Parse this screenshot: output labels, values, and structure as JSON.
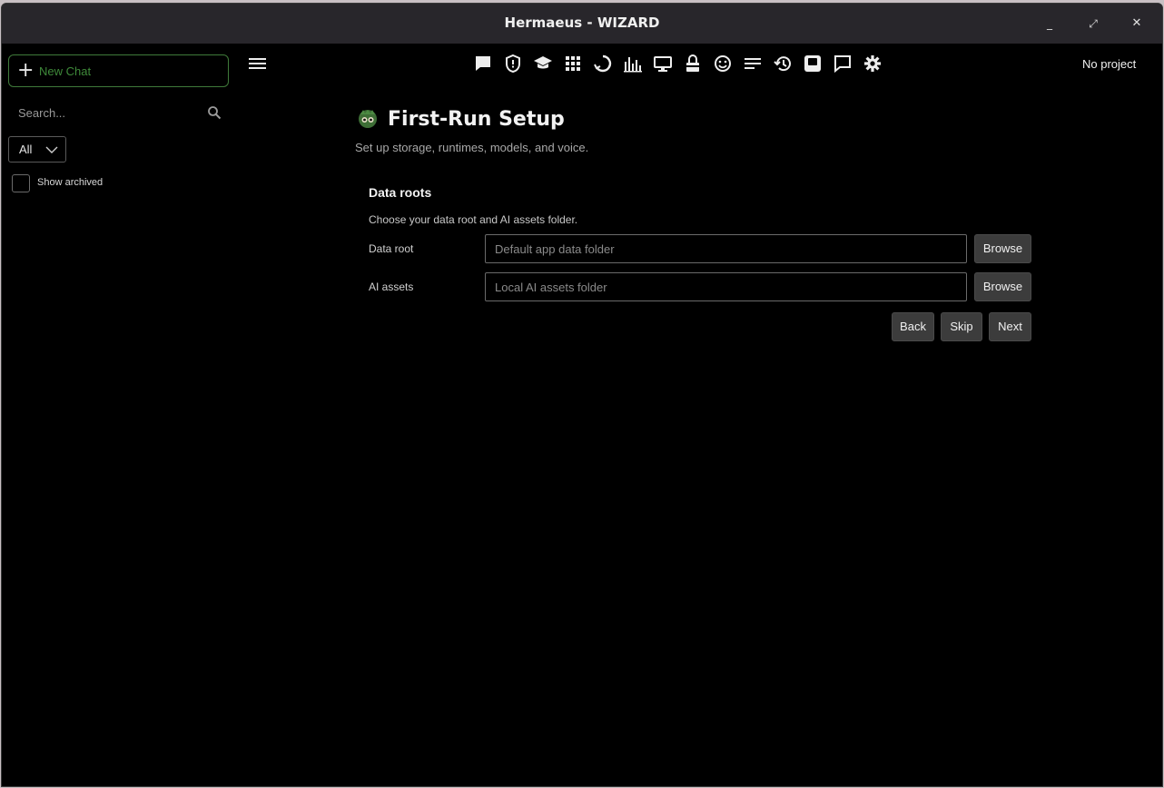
{
  "window": {
    "title": "Hermaeus - WIZARD",
    "minimize_glyph": "_",
    "maximize_glyph": "⤢",
    "close_glyph": "✕"
  },
  "sidebar": {
    "new_chat_label": "New Chat",
    "search_placeholder": "Search...",
    "filter_value": "All",
    "show_archived_label": "Show archived",
    "show_archived_checked": false
  },
  "toolbar": {
    "icons": [
      "chat-icon",
      "shield-icon",
      "graduation-cap-icon",
      "apps-grid-icon",
      "refresh-circle-icon",
      "bar-chart-icon",
      "monitor-icon",
      "lock-icon",
      "smiley-icon",
      "text-lines-icon",
      "history-icon",
      "active-panel-icon",
      "comment-icon",
      "gear-icon"
    ],
    "project_label": "No project"
  },
  "wizard": {
    "title": "First-Run Setup",
    "subtitle": "Set up storage, runtimes, models, and voice.",
    "section_title": "Data roots",
    "section_description": "Choose your data root and AI assets folder.",
    "fields": [
      {
        "label": "Data root",
        "placeholder": "Default app data folder",
        "value": "",
        "browse_label": "Browse"
      },
      {
        "label": "AI assets",
        "placeholder": "Local AI assets folder",
        "value": "",
        "browse_label": "Browse"
      }
    ],
    "buttons": {
      "back": "Back",
      "skip": "Skip",
      "next": "Next"
    }
  },
  "colors": {
    "background": "#000000",
    "titlebar": "#28262b",
    "accent_green": "#3f8a3a",
    "button_bg": "#3c3c3c"
  }
}
